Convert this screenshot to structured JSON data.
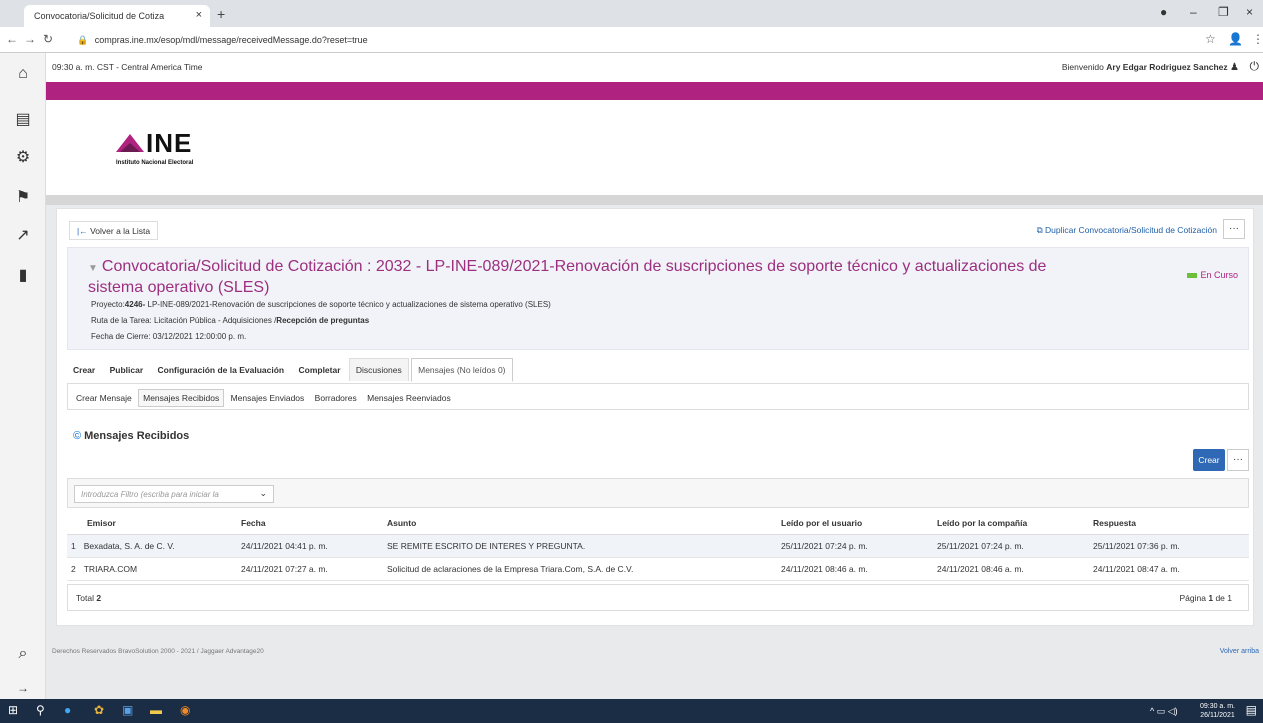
{
  "browser": {
    "tab_title": "Convocatoria/Solicitud de Cotiza",
    "tab_close": "×",
    "new_tab": "+",
    "url": "compras.ine.mx/esop/mdl/message/receivedMessage.do?reset=true",
    "window_controls": [
      "–",
      "❐",
      "×"
    ]
  },
  "header": {
    "time": "09:30 a. m. CST - Central America Time",
    "welcome_prefix": "Bienvenido",
    "user_name": "Ary Edgar Rodriguez Sanchez"
  },
  "logo": {
    "text": "INE",
    "subtitle": "Instituto Nacional Electoral"
  },
  "actions": {
    "back_label": "Volver a la Lista",
    "duplicate_label": "Duplicar Convocatoria/Solicitud de Cotización",
    "more_label": "···"
  },
  "summary": {
    "title": "Convocatoria/Solicitud de Cotización : 2032 - LP-INE-089/2021-Renovación de suscripciones de soporte técnico y actualizaciones de sistema operativo (SLES)",
    "project_label": "Proyecto:",
    "project_id": "4246-",
    "project_text": "LP-INE-089/2021-Renovación de suscripciones de soporte técnico y actualizaciones de sistema operativo (SLES)",
    "route_label": "Ruta de la Tarea: Licitación Pública - Adquisiciones /",
    "route_step": "Recepción de preguntas",
    "close_date": "Fecha de Cierre: 03/12/2021 12:00:00 p. m.",
    "status": "En Curso"
  },
  "tabs": [
    {
      "label": "Crear"
    },
    {
      "label": "Publicar"
    },
    {
      "label": "Configuración de la Evaluación"
    },
    {
      "label": "Completar"
    },
    {
      "label": "Discusiones"
    },
    {
      "label": "Mensajes (No leídos 0)"
    }
  ],
  "subtabs": [
    {
      "label": "Crear Mensaje"
    },
    {
      "label": "Mensajes Recibidos"
    },
    {
      "label": "Mensajes Enviados"
    },
    {
      "label": "Borradores"
    },
    {
      "label": "Mensajes Reenviados"
    }
  ],
  "section": {
    "title": "Mensajes Recibidos",
    "create_button": "Crear",
    "filter_placeholder": "Introduzca Filtro (escriba para iniciar la"
  },
  "table": {
    "columns": [
      "Emisor",
      "Fecha",
      "Asunto",
      "Leído por el usuario",
      "Leído por la compañía",
      "Respuesta"
    ],
    "rows": [
      {
        "n": "1",
        "emisor": "Bexadata, S. A. de C. V.",
        "fecha": "24/11/2021 04:41 p. m.",
        "asunto": "SE REMITE ESCRITO DE INTERES Y PREGUNTA.",
        "leido_usuario": "25/11/2021 07:24 p. m.",
        "leido_compania": "25/11/2021 07:24 p. m.",
        "respuesta": "25/11/2021 07:36 p. m."
      },
      {
        "n": "2",
        "emisor": "TRIARA.COM",
        "fecha": "24/11/2021 07:27 a. m.",
        "asunto": "Solicitud de aclaraciones de la Empresa Triara.Com, S.A. de C.V.",
        "leido_usuario": "24/11/2021 08:46 a. m.",
        "leido_compania": "24/11/2021 08:46 a. m.",
        "respuesta": "24/11/2021 08:47 a. m."
      }
    ],
    "total_label": "Total",
    "total_value": "2",
    "page_label": "Página",
    "page_current": "1",
    "page_of": "de 1"
  },
  "footer": {
    "copyright": "Derechos Reservados BravoSolution 2000 - 2021 / Jaggaer Advantage20",
    "back_to_top": "Volver arriba"
  },
  "taskbar": {
    "time": "09:30 a. m.",
    "date": "26/11/2021"
  },
  "colors": {
    "brand": "#b0227f",
    "title": "#9c2f7f",
    "primary_button": "#2f68b4",
    "link": "#1f5fa8",
    "status_square": "#6cbf3a"
  }
}
